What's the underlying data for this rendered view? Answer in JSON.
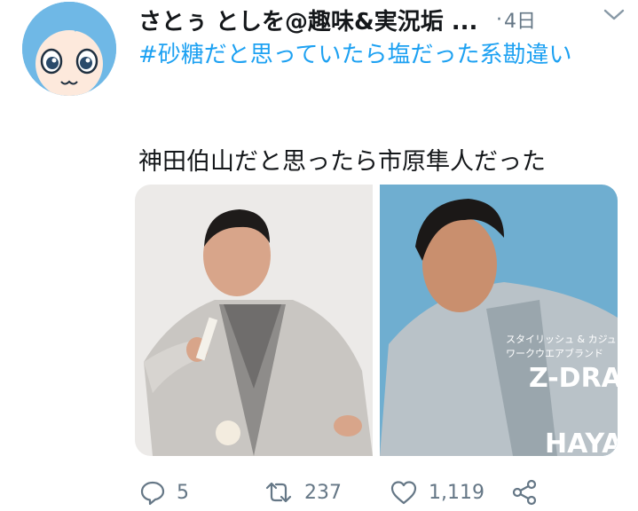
{
  "tweet": {
    "author_name": "さとぅ としを@趣味&実況垢 ...",
    "separator": "·",
    "time": "4日",
    "hashtag": "#砂糖だと思っていたら塩だった系勘違い",
    "text": "神田伯山だと思ったら市原隼人だった",
    "media": [
      {
        "icon": "photo-kanda-hakuzan"
      },
      {
        "icon": "photo-ichihara-hayato",
        "overlay_lines": [
          "スタイリッシュ & カジュ",
          "ワークウエアブランド",
          "Z-DRA",
          "HAYA"
        ]
      }
    ]
  },
  "actions": {
    "reply_count": "5",
    "retweet_count": "237",
    "like_count": "1,119"
  },
  "colors": {
    "link": "#1da1f2",
    "secondary_text": "#657786",
    "primary_text": "#14171a"
  }
}
